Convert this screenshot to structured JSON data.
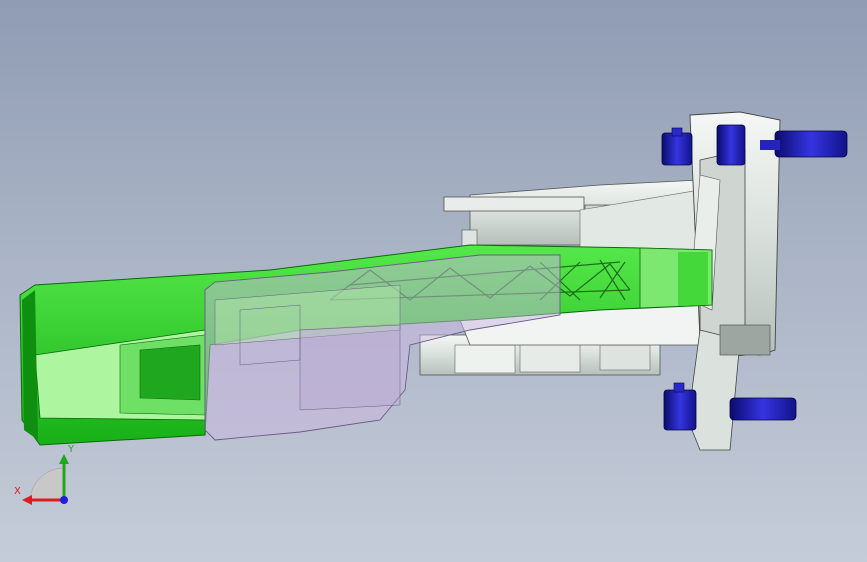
{
  "viewport": {
    "background_top": "#8f9cb3",
    "background_bottom": "#c5ccd9"
  },
  "model": {
    "colors": {
      "arm": "#2ed82e",
      "arm_dark": "#13a013",
      "arm_light": "#aef5a0",
      "ghost": "#c9b6e0",
      "bracket": "#e4e9e6",
      "bracket_shadow": "#9aa3a0",
      "bolt": "#2a2acc",
      "bolt_dark": "#0b0b6e"
    }
  },
  "triad": {
    "x_label": "X",
    "y_label": "Y",
    "x_color": "#d81e1e",
    "y_color": "#1ea81e",
    "z_color": "#1e1ed8",
    "icon": "axis-triad-icon"
  }
}
